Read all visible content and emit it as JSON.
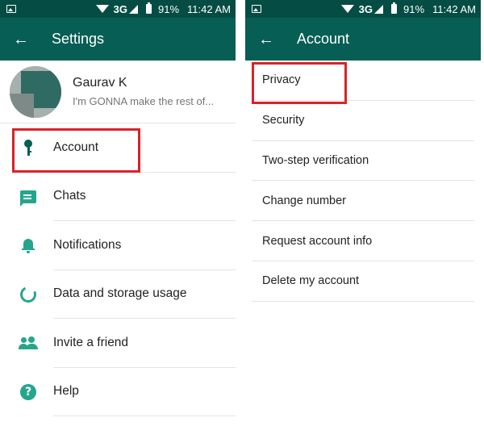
{
  "status_bar": {
    "network": "3G",
    "battery": "91%",
    "time": "11:42 AM"
  },
  "settings_screen": {
    "title": "Settings",
    "profile": {
      "name": "Gaurav K",
      "status": "I'm GONNA make the rest of..."
    },
    "items": [
      {
        "label": "Account",
        "icon": "key-icon"
      },
      {
        "label": "Chats",
        "icon": "chat-icon"
      },
      {
        "label": "Notifications",
        "icon": "bell-icon"
      },
      {
        "label": "Data and storage usage",
        "icon": "data-usage-icon"
      },
      {
        "label": "Invite a friend",
        "icon": "people-icon"
      },
      {
        "label": "Help",
        "icon": "help-icon"
      }
    ]
  },
  "account_screen": {
    "title": "Account",
    "items": [
      {
        "label": "Privacy"
      },
      {
        "label": "Security"
      },
      {
        "label": "Two-step verification"
      },
      {
        "label": "Change number"
      },
      {
        "label": "Request account info"
      },
      {
        "label": "Delete my account"
      }
    ]
  },
  "colors": {
    "status_bar": "#054d44",
    "app_bar": "#075e54",
    "icon_accent": "#24a68c",
    "highlight": "#d9222a"
  }
}
